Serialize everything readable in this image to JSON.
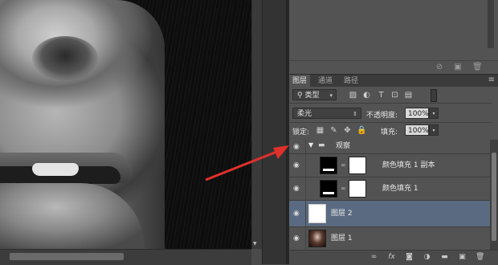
{
  "colors": {
    "arrow": "#e0302a",
    "selected_row": "#5a6a80",
    "panel_bg": "#535353"
  },
  "top_icons": [
    "block-icon",
    "new-icon",
    "trash-icon"
  ],
  "tabs": [
    {
      "label": "图层"
    },
    {
      "label": "通道"
    },
    {
      "label": "路径"
    }
  ],
  "filter": {
    "kind_label": "类型",
    "icons": [
      "image-filter-icon",
      "adjustment-filter-icon",
      "type-filter-icon",
      "shape-filter-icon",
      "smart-filter-icon"
    ]
  },
  "blend": {
    "mode": "柔光",
    "opacity_label": "不透明度:",
    "opacity_value": "100%"
  },
  "lock": {
    "label": "锁定:",
    "fill_label": "填充:",
    "fill_value": "100%"
  },
  "layers": [
    {
      "name": "观察",
      "type": "group"
    },
    {
      "name": "颜色填充 1 副本",
      "type": "fill"
    },
    {
      "name": "颜色填充 1",
      "type": "fill"
    },
    {
      "name": "图层 2",
      "type": "layer",
      "selected": true
    },
    {
      "name": "图层 1",
      "type": "layer"
    }
  ],
  "bottom_icons": [
    "link-icon",
    "fx-icon",
    "mask-icon",
    "adjustment-icon",
    "folder-icon",
    "new-layer-icon",
    "trash-icon"
  ]
}
